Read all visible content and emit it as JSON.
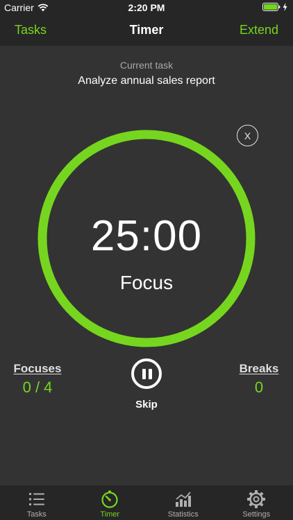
{
  "status_bar": {
    "carrier": "Carrier",
    "time": "2:20 PM"
  },
  "nav": {
    "left_label": "Tasks",
    "title": "Timer",
    "right_label": "Extend"
  },
  "task": {
    "caption": "Current task",
    "name": "Analyze annual sales report"
  },
  "close_label": "X",
  "timer": {
    "time": "25:00",
    "mode": "Focus",
    "progress": 1.0,
    "ring_color": "#76d61f"
  },
  "counters": {
    "focuses_label": "Focuses",
    "focuses_value": "0 / 4",
    "breaks_label": "Breaks",
    "breaks_value": "0"
  },
  "controls": {
    "pause_icon": "pause-icon",
    "skip_label": "Skip"
  },
  "tabs": [
    {
      "label": "Tasks",
      "icon": "list-icon",
      "active": false
    },
    {
      "label": "Timer",
      "icon": "timer-icon",
      "active": true
    },
    {
      "label": "Statistics",
      "icon": "chart-icon",
      "active": false
    },
    {
      "label": "Settings",
      "icon": "gear-icon",
      "active": false
    }
  ],
  "colors": {
    "accent": "#76d61f",
    "background": "#333333",
    "bar": "#262626",
    "inactive": "#b0b0b0"
  }
}
